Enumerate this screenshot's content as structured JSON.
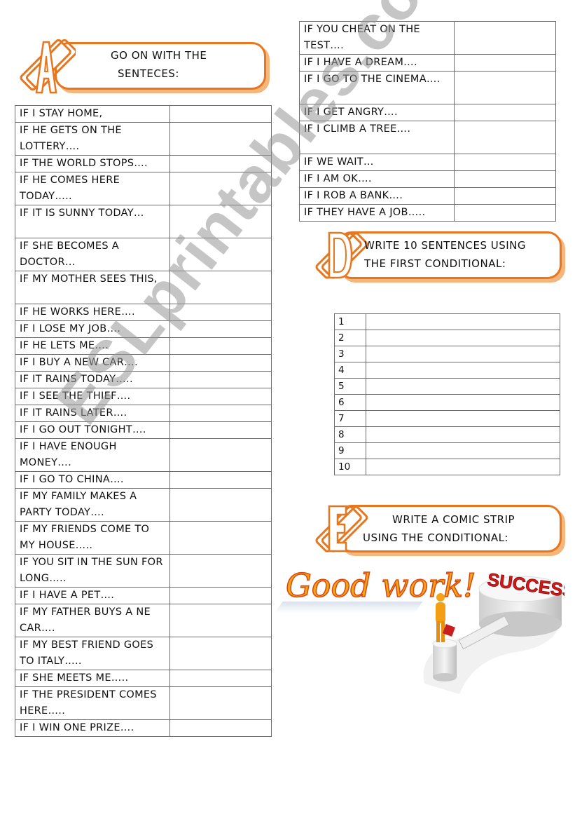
{
  "section_a": {
    "badge_letter": "A",
    "title_line1": "GO ON WITH THE",
    "title_line2": "SENTECES:",
    "rows": [
      "IF I STAY HOME,",
      "IF HE GETS ON THE LOTTERY….",
      "IF THE WORLD STOPS….",
      "IF HE COMES HERE TODAY…..",
      "IF IT IS SUNNY TODAY…",
      "IF SHE BECOMES A DOCTOR…",
      "IF MY MOTHER SEES THIS,",
      "IF HE WORKS HERE….",
      "IF I LOSE MY JOB….",
      "IF HE LETS ME….",
      "IF I BUY A NEW CAR….",
      "IF IT RAINS TODAY…..",
      "IF I SEE THE THIEF….",
      "IF IT RAINS LATER….",
      "IF I GO OUT TONIGHT….",
      "IF I HAVE ENOUGH MONEY….",
      "IF I GO TO CHINA….",
      "IF MY FAMILY MAKES A PARTY TODAY….",
      "IF MY FRIENDS COME TO MY HOUSE…..",
      "IF YOU SIT IN THE SUN FOR LONG…..",
      "IF I HAVE A PET….",
      "IF MY FATHER BUYS A NE CAR….",
      "IF MY BEST FRIEND GOES TO ITALY…..",
      "IF SHE MEETS ME…..",
      "IF THE PRESIDENT COMES HERE…..",
      "IF I WIN ONE PRIZE…."
    ]
  },
  "section_c": {
    "rows": [
      "IF YOU CHEAT ON THE TEST….",
      "IF I HAVE A DREAM….",
      "IF I GO TO THE CINEMA….",
      "IF I GET ANGRY….",
      "IF I CLIMB A TREE….",
      "IF WE WAIT…",
      "IF I AM OK….",
      "IF I ROB A BANK….",
      "IF THEY HAVE A JOB….."
    ]
  },
  "section_d": {
    "badge_letter": "D",
    "title_line1": "WRITE 10 SENTENCES USING",
    "title_line2": "THE FIRST CONDITIONAL:",
    "numbers": [
      "1",
      "2",
      "3",
      "4",
      "5",
      "6",
      "7",
      "8",
      "9",
      "10"
    ]
  },
  "section_e": {
    "badge_letter": "E",
    "title_line1": "WRITE A COMIC STRIP",
    "title_line2": "USING THE CONDITIONAL:"
  },
  "closing": {
    "good_work": "Good work!",
    "success_label": "SUCCESS"
  },
  "watermark": "ESLprintables.com",
  "colors": {
    "accent": "#e8761e",
    "accent_light": "#f6b57a",
    "border": "#6b6b6b"
  }
}
